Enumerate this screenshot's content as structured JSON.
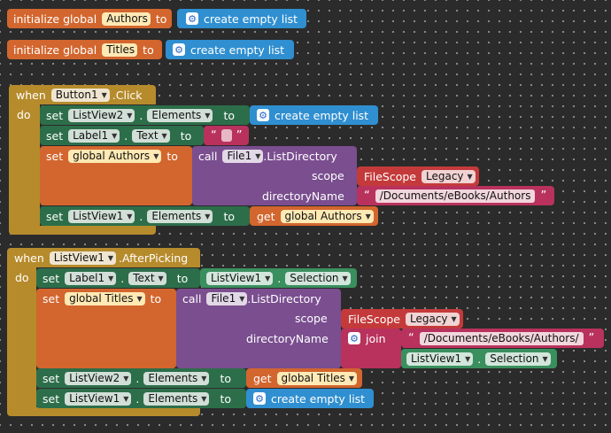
{
  "globals": [
    {
      "keyword": "initialize global",
      "name": "Authors",
      "to": "to",
      "value": "create empty list"
    },
    {
      "keyword": "initialize global",
      "name": "Titles",
      "to": "to",
      "value": "create empty list"
    }
  ],
  "event1": {
    "when": "when",
    "component": "Button1",
    "event": ".Click",
    "do": "do",
    "stmt1": {
      "set": "set",
      "component": "ListView2",
      "prop": "Elements",
      "to": "to",
      "value": "create empty list"
    },
    "stmt2": {
      "set": "set",
      "component": "Label1",
      "prop": "Text",
      "to": "to",
      "quote_open": "“",
      "quote_close": "”"
    },
    "stmt3": {
      "set": "set",
      "var": "global Authors",
      "to": "to",
      "call": "call",
      "component": "File1",
      "method": ".ListDirectory",
      "scope_label": "scope",
      "scope_keyword": "FileScope",
      "scope_value": "Legacy",
      "dir_label": "directoryName",
      "dir_value": "/Documents/eBooks/Authors",
      "quote_open": "“",
      "quote_close": "”"
    },
    "stmt4": {
      "set": "set",
      "component": "ListView1",
      "prop": "Elements",
      "to": "to",
      "get": "get",
      "var": "global Authors"
    }
  },
  "event2": {
    "when": "when",
    "component": "ListView1",
    "event": ".AfterPicking",
    "do": "do",
    "stmt1": {
      "set": "set",
      "component": "Label1",
      "prop": "Text",
      "to": "to",
      "value_component": "ListView1",
      "value_prop": "Selection"
    },
    "stmt2": {
      "set": "set",
      "var": "global Titles",
      "to": "to",
      "call": "call",
      "component": "File1",
      "method": ".ListDirectory",
      "scope_label": "scope",
      "scope_keyword": "FileScope",
      "scope_value": "Legacy",
      "dir_label": "directoryName",
      "join": "join",
      "dir_value": "/Documents/eBooks/Authors/",
      "join_component": "ListView1",
      "join_prop": "Selection",
      "quote_open": "“",
      "quote_close": "”"
    },
    "stmt3": {
      "set": "set",
      "component": "ListView2",
      "prop": "Elements",
      "to": "to",
      "get": "get",
      "var": "global Titles"
    },
    "stmt4": {
      "set": "set",
      "component": "ListView1",
      "prop": "Elements",
      "to": "to",
      "value": "create empty list"
    }
  },
  "icons": {
    "gear": "gear-icon",
    "dropdown": "dropdown-arrow-icon"
  },
  "colors": {
    "variables": "#d2662e",
    "lists": "#2f8fd0",
    "control": "#b68b2c",
    "components": "#2d6e4a",
    "file_call": "#7a4e8f",
    "helper": "#c43a3a",
    "text": "#b8325d"
  }
}
